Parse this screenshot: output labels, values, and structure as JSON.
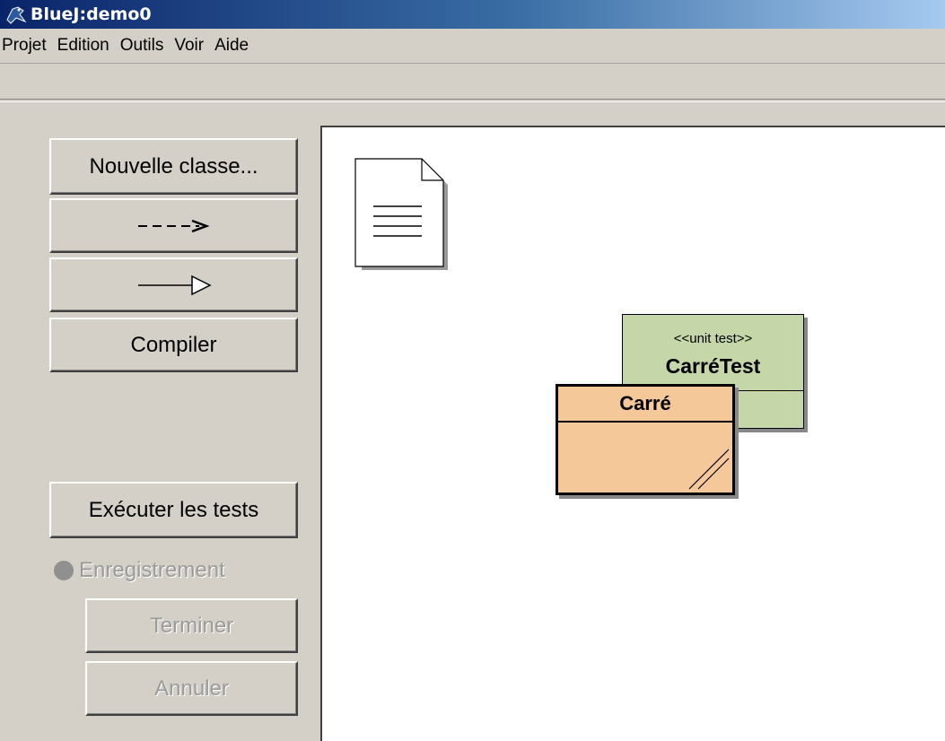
{
  "window": {
    "title": "BlueJ:demo0"
  },
  "menu": [
    "Projet",
    "Edition",
    "Outils",
    "Voir",
    "Aide"
  ],
  "toolbar": {
    "new_class": "Nouvelle classe...",
    "compile": "Compiler",
    "run_tests": "Exécuter les tests",
    "recording": "Enregistrement",
    "end": "Terminer",
    "cancel": "Annuler"
  },
  "diagram": {
    "test_class": {
      "stereotype": "<<unit test>>",
      "name": "CarréTest",
      "color": "#c5d6a8"
    },
    "main_class": {
      "name": "Carré",
      "color": "#f4c898"
    }
  }
}
